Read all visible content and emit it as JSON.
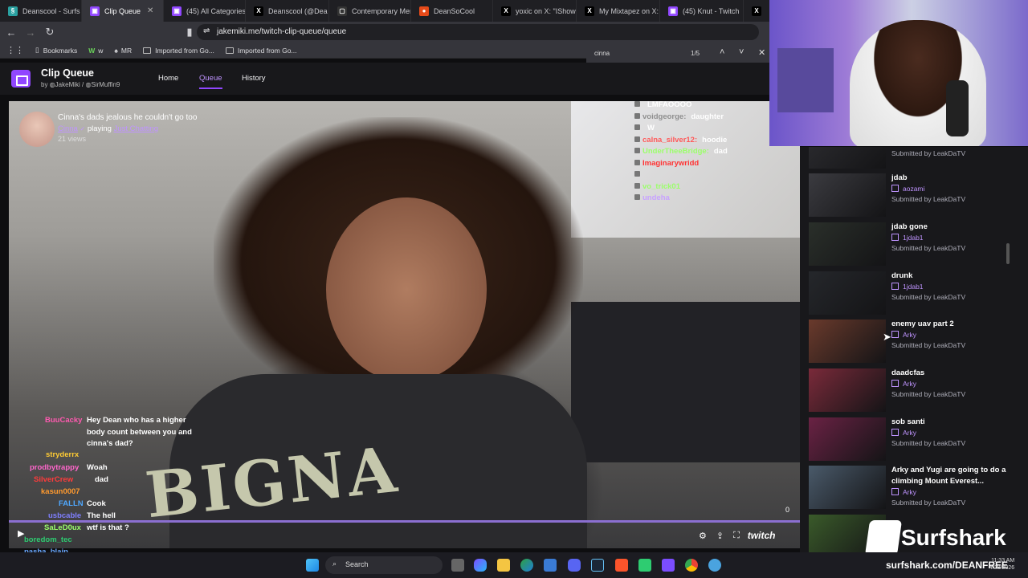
{
  "browser": {
    "tabs": [
      {
        "label": "Deanscool - Surfs",
        "fav": "§",
        "color": "#2aa1a1"
      },
      {
        "label": "Clip Queue",
        "fav": "▣",
        "color": "#9147ff",
        "active": true
      },
      {
        "label": "(45) All Categories",
        "fav": "▣",
        "color": "#9147ff"
      },
      {
        "label": "Deanscool (@Dea",
        "fav": "X",
        "color": "#000000"
      },
      {
        "label": "Contemporary Men",
        "fav": "▢",
        "color": "#333333"
      },
      {
        "label": "DeanSoCool",
        "fav": "●",
        "color": "#e64a19"
      },
      {
        "label": "yoxic on X: \"IShowS",
        "fav": "X",
        "color": "#000000"
      },
      {
        "label": "My Mixtapez on X:",
        "fav": "X",
        "color": "#000000"
      },
      {
        "label": "(45) Knut - Twitch",
        "fav": "▣",
        "color": "#9147ff"
      },
      {
        "label": "",
        "fav": "X",
        "color": "#000000"
      }
    ],
    "url": "jakemiki.me/twitch-clip-queue/queue",
    "bookmarks": [
      "Bookmarks",
      "w",
      "MR",
      "Imported from Go...",
      "Imported from Go..."
    ],
    "find": {
      "query": "cinna",
      "count": "1/5"
    }
  },
  "app": {
    "title": "Clip Queue",
    "by_prefix": "by",
    "author1": "JakeMiki",
    "sep": "/",
    "author2": "SirMuffin9",
    "nav": [
      "Home",
      "Queue",
      "History"
    ],
    "brand_color": "#9147ff"
  },
  "clip": {
    "title": "Cinna's dads jealous he couldn't go too",
    "channel": "Cinna",
    "playing": "playing",
    "category": "Just Chatting",
    "views": "21 views",
    "counter": "0",
    "video_text": "BIGNA",
    "twitch_label": "twitch"
  },
  "video_chat": [
    {
      "user": "",
      "msg": "LMFAOOOO",
      "color": "#ff4d4d"
    },
    {
      "user": "voidgeorge:",
      "msg": "daughter",
      "color": "#8f8f8f"
    },
    {
      "user": "",
      "msg": "W",
      "color": "#8f8f8f"
    },
    {
      "user": "calna_silver12:",
      "msg": "hoodie",
      "color": "#ff5a5a"
    },
    {
      "user": "UnderTheeBridge:",
      "msg": "dad",
      "color": "#9bff6a"
    },
    {
      "user": "Imaginarywridd",
      "msg": "",
      "color": "#ff3333"
    },
    {
      "user": "",
      "msg": "",
      "color": "#ffffff"
    },
    {
      "user": "vo_trick01",
      "msg": "",
      "color": "#9bff6a"
    },
    {
      "user": "undeha",
      "msg": "",
      "color": "#c8a2ff"
    }
  ],
  "stream_chat": [
    {
      "user": "BuuCacky",
      "msg": "Hey Dean who has a higher",
      "color": "#ff5ab0"
    },
    {
      "user": "",
      "msg": "body count between you and",
      "color": "#ffffff"
    },
    {
      "user": "",
      "msg": "cinna's dad?",
      "color": "#ffffff"
    },
    {
      "user": "stryderrx",
      "msg": "",
      "color": "#ffcc33"
    },
    {
      "user": "prodbytrappy",
      "msg": "Woah",
      "color": "#ff66cc"
    },
    {
      "user": "SilverCrew",
      "msg": "dad",
      "color": "#ff3b3b"
    },
    {
      "user": "kasun0007",
      "msg": "",
      "color": "#ff9a2e"
    },
    {
      "user": "FALLN",
      "msg": "Cook",
      "color": "#4fa8ff"
    },
    {
      "user": "usbcable",
      "msg": "The hell",
      "color": "#7f7fff"
    },
    {
      "user": "SaLeD0ux",
      "msg": "wtf is that ?",
      "color": "#9bff6a"
    },
    {
      "user": "boredom_tec",
      "msg": "",
      "color": "#2ecc71"
    },
    {
      "user": "pasha_blain",
      "msg": "",
      "color": "#6aa8ff"
    }
  ],
  "queue": [
    {
      "title": "",
      "channel": "",
      "submitted": "Submitted by LeakDaTV"
    },
    {
      "title": "jdab",
      "channel": "aozami",
      "submitted": "Submitted by LeakDaTV"
    },
    {
      "title": "jdab gone",
      "channel": "1jdab1",
      "submitted": "Submitted by LeakDaTV"
    },
    {
      "title": "drunk",
      "channel": "1jdab1",
      "submitted": "Submitted by LeakDaTV"
    },
    {
      "title": "enemy uav part 2",
      "channel": "Arky",
      "submitted": "Submitted by LeakDaTV"
    },
    {
      "title": "daadcfas",
      "channel": "Arky",
      "submitted": "Submitted by LeakDaTV"
    },
    {
      "title": "sob santi",
      "channel": "Arky",
      "submitted": "Submitted by LeakDaTV"
    },
    {
      "title": "Arky and Yugi are going to do a",
      "title2": "climbing Mount Everest...",
      "channel": "Arky",
      "submitted": "Submitted by LeakDaTV"
    },
    {
      "title": "",
      "channel": "",
      "submitted": ""
    }
  ],
  "sponsor": {
    "name": "Surfshark",
    "url": "surfshark.com/DEANFREE"
  },
  "taskbar": {
    "search": "Search",
    "time": "11:33 AM",
    "date": "4/28/2026"
  }
}
